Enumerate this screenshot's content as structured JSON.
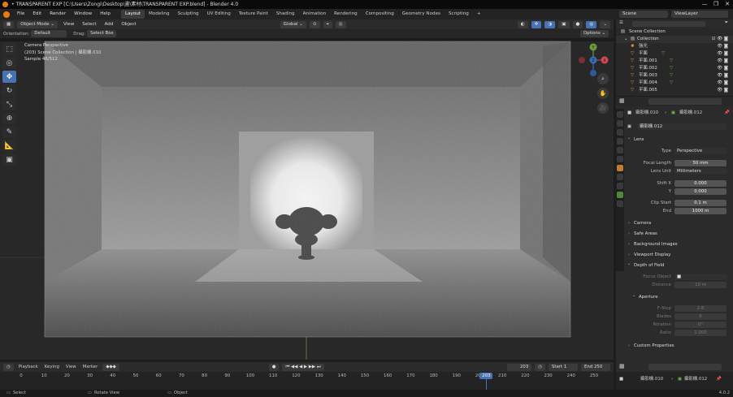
{
  "window": {
    "title": "• TRANSPARENT EXP [C:\\Users\\Zongi\\Desktop\\畫\\素材\\TRANSPARENT EXP.blend] - Blender 4.0",
    "controls": [
      "—",
      "❐",
      "✕"
    ]
  },
  "menu": {
    "items": [
      "File",
      "Edit",
      "Render",
      "Window",
      "Help"
    ],
    "workspaces": [
      "Layout",
      "Modeling",
      "Sculpting",
      "UV Editing",
      "Texture Paint",
      "Shading",
      "Animation",
      "Rendering",
      "Compositing",
      "Geometry Nodes",
      "Scripting",
      "+"
    ],
    "active_workspace": "Layout",
    "scene": "Scene",
    "view_layer": "ViewLayer"
  },
  "viewport_header": {
    "mode": "Object Mode",
    "menus": [
      "View",
      "Select",
      "Add",
      "Object"
    ],
    "transform_orientation": "Global",
    "options": "Options"
  },
  "tool_header": {
    "orientation_label": "Orientation:",
    "orientation_value": "Default",
    "drag_label": "Drag:",
    "drag_value": "Select Box"
  },
  "viewport_overlay": {
    "line1": "Camera Perspective",
    "line2": "(203) Scene Collection | 攝影機.010",
    "line3": "Sample 46/512"
  },
  "gizmo": {
    "x": "X",
    "y": "Y",
    "z": "Z"
  },
  "timeline": {
    "menus": [
      "Playback",
      "Keying",
      "View",
      "Marker"
    ],
    "current_frame": "203",
    "start_label": "Start",
    "start": "1",
    "end_label": "End",
    "end": "250",
    "ticks": [
      "0",
      "10",
      "20",
      "30",
      "40",
      "50",
      "60",
      "70",
      "80",
      "90",
      "100",
      "110",
      "120",
      "130",
      "140",
      "150",
      "160",
      "170",
      "180",
      "190",
      "200",
      "210",
      "220",
      "230",
      "240",
      "250"
    ],
    "playhead": "203"
  },
  "statusbar": {
    "select": "Select",
    "rotate": "Rotate View",
    "object": "Object",
    "version": "4.0.2"
  },
  "outliner": {
    "header": "Scene Collection",
    "collection": "Collection",
    "items": [
      "強光",
      "平面",
      "平面.001",
      "平面.002",
      "平面.003",
      "平面.004",
      "平面.005"
    ]
  },
  "properties": {
    "breadcrumb_obj": "攝影機.010",
    "breadcrumb_data": "攝影機.012",
    "datablock": "攝影機.012",
    "lens_panel": "Lens",
    "type_label": "Type",
    "type_value": "Perspective",
    "focal_label": "Focal Length",
    "focal_value": "50 mm",
    "lens_unit_label": "Lens Unit",
    "lens_unit_value": "Millimeters",
    "shift_x_label": "Shift X",
    "shift_x_value": "0.000",
    "shift_y_label": "Y",
    "shift_y_value": "0.000",
    "clip_start_label": "Clip Start",
    "clip_start_value": "0.1 m",
    "clip_end_label": "End",
    "clip_end_value": "1000 m",
    "camera_panel": "Camera",
    "safe_areas_panel": "Safe Areas",
    "background_images_panel": "Background Images",
    "viewport_display_panel": "Viewport Display",
    "dof_panel": "Depth of Field",
    "focus_object_label": "Focus Object",
    "distance_label": "Distance",
    "distance_value": "10 m",
    "aperture_panel": "Aperture",
    "fstop_label": "F-Stop",
    "fstop_value": "2.8",
    "blades_label": "Blades",
    "blades_value": "0",
    "rotation_label": "Rotation",
    "rotation_value": "0°",
    "ratio_label": "Ratio",
    "ratio_value": "1.000",
    "custom_props_panel": "Custom Properties"
  },
  "bottom_right": {
    "breadcrumb_obj": "攝影機.010",
    "breadcrumb_data": "攝影機.012"
  }
}
